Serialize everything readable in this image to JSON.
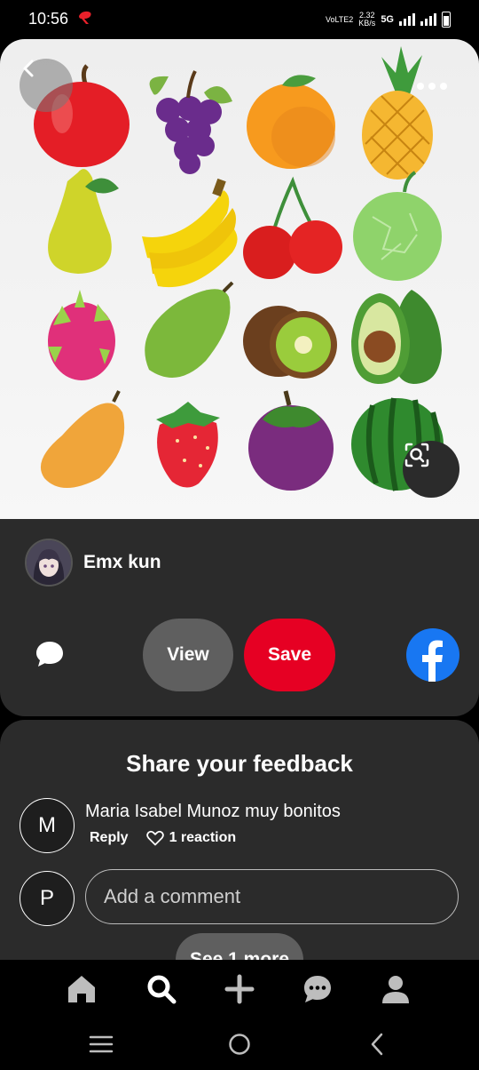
{
  "status_bar": {
    "time": "10:56",
    "volte_label": "VoLTE2",
    "speed_value": "2.32",
    "speed_unit": "KB/s",
    "network": "5G"
  },
  "pin": {
    "creator_name": "Emx kun",
    "view_label": "View",
    "save_label": "Save",
    "icons": [
      "chevron-left-icon",
      "more-dots-icon",
      "visual-search-icon",
      "comment-icon",
      "facebook-icon"
    ]
  },
  "feedback": {
    "title": "Share your feedback",
    "comments": [
      {
        "initial": "M",
        "text": "Maria Isabel Munoz muy bonitos",
        "reply_label": "Reply",
        "reaction_label": "1 reaction"
      }
    ],
    "current_user_initial": "P",
    "input_placeholder": "Add a comment",
    "see_more_label": "See 1 more"
  },
  "bottom_nav": [
    "home-icon",
    "search-icon",
    "create-icon",
    "messages-icon",
    "profile-icon"
  ],
  "system_nav": [
    "recents-icon",
    "home-circle-icon",
    "back-icon"
  ],
  "colors": {
    "save": "#e60023",
    "facebook": "#1877f2",
    "card": "#2b2b2b",
    "view": "#5f5f5f"
  }
}
